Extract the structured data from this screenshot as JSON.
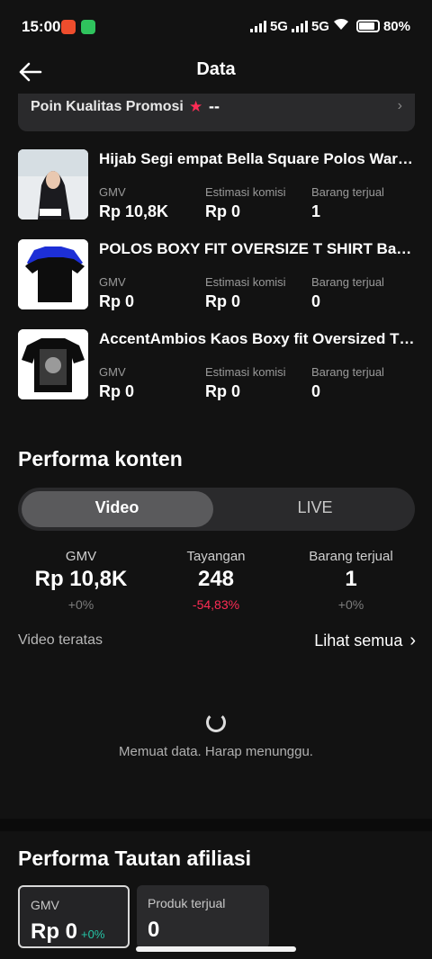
{
  "status_bar": {
    "time": "15:00",
    "network1": "5G",
    "network2": "5G",
    "battery": "80%"
  },
  "header": {
    "title": "Data"
  },
  "promo": {
    "label": "Poin Kualitas Promosi",
    "value": "--"
  },
  "products": [
    {
      "title": "Hijab Segi empat Bella Square Polos Warna Hitam",
      "metrics": [
        {
          "label": "GMV",
          "value": "Rp 10,8K"
        },
        {
          "label": "Estimasi komisi",
          "value": "Rp 0"
        },
        {
          "label": "Barang terjual",
          "value": "1"
        }
      ]
    },
    {
      "title": "POLOS BOXY FIT OVERSIZE T SHIRT Baju Kaos",
      "metrics": [
        {
          "label": "GMV",
          "value": "Rp 0"
        },
        {
          "label": "Estimasi komisi",
          "value": "Rp 0"
        },
        {
          "label": "Barang terjual",
          "value": "0"
        }
      ]
    },
    {
      "title": "AccentAmbios Kaos Boxy fit Oversized T Shirt",
      "metrics": [
        {
          "label": "GMV",
          "value": "Rp 0"
        },
        {
          "label": "Estimasi komisi",
          "value": "Rp 0"
        },
        {
          "label": "Barang terjual",
          "value": "0"
        }
      ]
    }
  ],
  "content_performance": {
    "title": "Performa konten",
    "tabs": [
      {
        "label": "Video",
        "active": true
      },
      {
        "label": "LIVE",
        "active": false
      }
    ],
    "stats": [
      {
        "label": "GMV",
        "value": "Rp 10,8K",
        "change": "+0%"
      },
      {
        "label": "Tayangan",
        "value": "248",
        "change": "-54,83%"
      },
      {
        "label": "Barang terjual",
        "value": "1",
        "change": "+0%"
      }
    ],
    "top_video_label": "Video teratas",
    "see_all": "Lihat semua",
    "loading_text": "Memuat data. Harap menunggu."
  },
  "affiliate_performance": {
    "title": "Performa Tautan afiliasi",
    "cards": [
      {
        "label": "GMV",
        "value": "Rp 0",
        "change": "+0%"
      },
      {
        "label": "Produk terjual",
        "value": "0"
      }
    ]
  },
  "colors": {
    "accent": "#fe2c55",
    "positive": "#25c4a6",
    "background": "#121212",
    "card": "#2a2a2c"
  }
}
